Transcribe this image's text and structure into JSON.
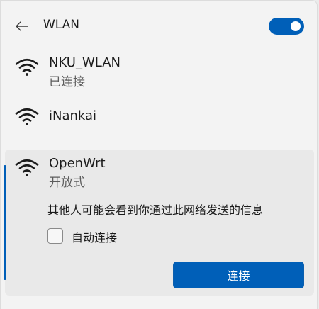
{
  "header": {
    "title": "WLAN",
    "back_icon": "arrow-left-icon",
    "wlan_toggle_on": true
  },
  "networks": [
    {
      "name": "NKU_WLAN",
      "status": "已连接",
      "icon": "wifi-icon"
    },
    {
      "name": "iNankai",
      "icon": "wifi-icon"
    },
    {
      "name": "OpenWrt",
      "status": "开放式",
      "icon": "wifi-icon"
    }
  ],
  "expanded": {
    "warning": "其他人可能会看到你通过此网络发送的信息",
    "auto_connect_label": "自动连接",
    "auto_connect_checked": false,
    "connect_button": "连接"
  },
  "colors": {
    "accent": "#005fb8",
    "background": "#f3f3f3",
    "expanded_background": "#e9e9e9"
  }
}
